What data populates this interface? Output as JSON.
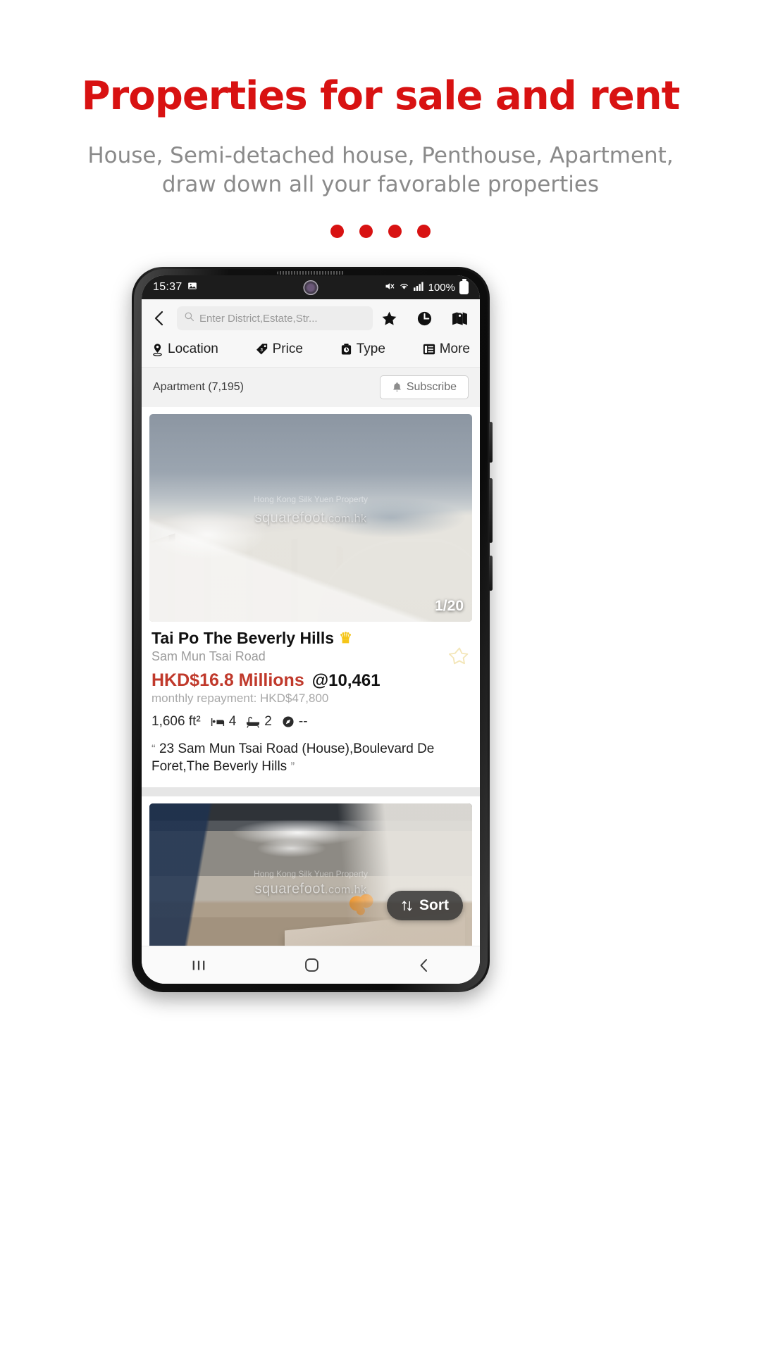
{
  "promo": {
    "title": "Properties for sale and rent",
    "subtitle_line1": "House, Semi-detached house, Penthouse, Apartment,",
    "subtitle_line2": "draw down all your favorable properties",
    "dot_count": 4,
    "accent_color": "#d81212",
    "subtitle_color": "#8a8a8a"
  },
  "status_bar": {
    "time": "15:37",
    "image_icon": "image-icon",
    "mute_icon": "mute-icon",
    "wifi_icon": "wifi-icon",
    "signal_icon": "signal-bars-icon",
    "battery_percent": "100%",
    "battery_icon": "battery-full-icon"
  },
  "app_bar": {
    "back_icon": "back-chevron-icon",
    "search": {
      "icon": "search-icon",
      "placeholder": "Enter District,Estate,Str...",
      "value": ""
    },
    "actions": [
      {
        "name": "favorites",
        "icon": "star-filled-icon"
      },
      {
        "name": "history",
        "icon": "clock-icon"
      },
      {
        "name": "map",
        "icon": "map-pin-icon"
      }
    ]
  },
  "filters": [
    {
      "label": "Location",
      "icon": "location-pin-icon"
    },
    {
      "label": "Price",
      "icon": "price-tag-icon"
    },
    {
      "label": "Type",
      "icon": "type-box-icon"
    },
    {
      "label": "More",
      "icon": "more-list-icon"
    }
  ],
  "result_header": {
    "count_label": "Apartment (7,195)",
    "subscribe_label": "Subscribe",
    "subscribe_icon": "bell-icon"
  },
  "listings": [
    {
      "image_counter": "1/20",
      "watermark_main": "squarefoot",
      "watermark_suffix": ".com.hk",
      "watermark_small": "Hong Kong Silk Yuen Property",
      "title": "Tai Po The Beverly Hills",
      "badge_icon": "crown-icon",
      "subtitle": "Sam Mun Tsai Road",
      "price": "HKD$16.8 Millions",
      "unit_price": "@10,461",
      "repayment": "monthly repayment: HKD$47,800",
      "area": "1,606 ft²",
      "bedrooms": "4",
      "bathrooms": "2",
      "orientation": "--",
      "bed_icon": "bed-icon",
      "bath_icon": "bathtub-icon",
      "compass_icon": "compass-icon",
      "description": "23 Sam Mun Tsai Road (House),Boulevard De Foret,The Beverly Hills",
      "quote_open": "“",
      "quote_close": "”",
      "favorite_icon": "star-outline-icon"
    },
    {
      "watermark_main": "squarefoot",
      "watermark_suffix": ".com.hk",
      "watermark_small": "Hong Kong Silk Yuen Property"
    }
  ],
  "sort_button": {
    "label": "Sort",
    "icon": "sort-arrows-icon"
  },
  "android_nav": {
    "recents_label": "|||",
    "home_icon": "home-circle-icon",
    "back_icon": "nav-back-icon"
  }
}
